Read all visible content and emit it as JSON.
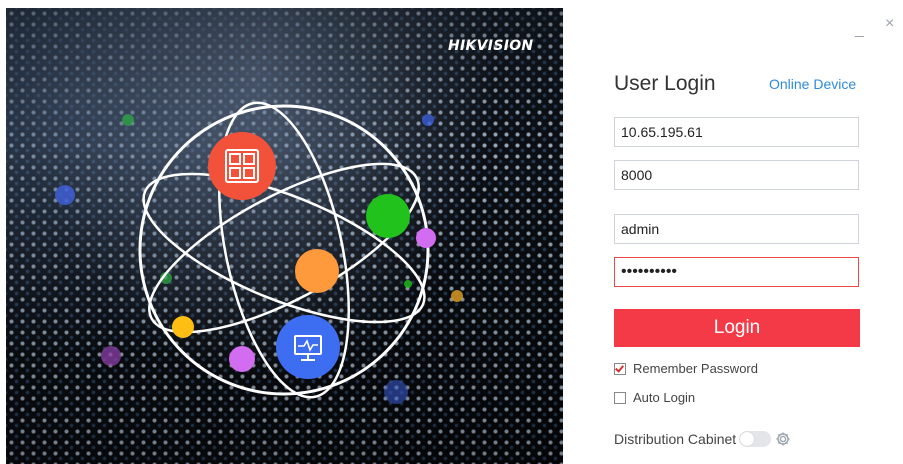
{
  "brand": "HIKVISION",
  "window": {
    "minimize_glyph": "_",
    "close_glyph": "×"
  },
  "login": {
    "title": "User Login",
    "online_device_link": "Online Device",
    "ip_value": "10.65.195.61",
    "port_value": "8000",
    "username_value": "admin",
    "password_value": "••••••••••",
    "login_button": "Login",
    "remember_password": {
      "label": "Remember Password",
      "checked": true
    },
    "auto_login": {
      "label": "Auto Login",
      "checked": false
    },
    "distribution_cabinet": {
      "label": "Distribution Cabinet",
      "enabled": false
    }
  },
  "icons": {
    "window": "window-layout-icon",
    "monitor": "monitor-icon",
    "gear": "gear-icon"
  },
  "colors": {
    "accent_red": "#f53a47",
    "link_blue": "#2e8bd8",
    "node_red": "#f2523a",
    "node_green": "#21c21c",
    "node_orange": "#ff9a3c",
    "node_blue": "#3d6df0",
    "node_purple": "#d26cf0",
    "node_yellow": "#ffbe14"
  }
}
